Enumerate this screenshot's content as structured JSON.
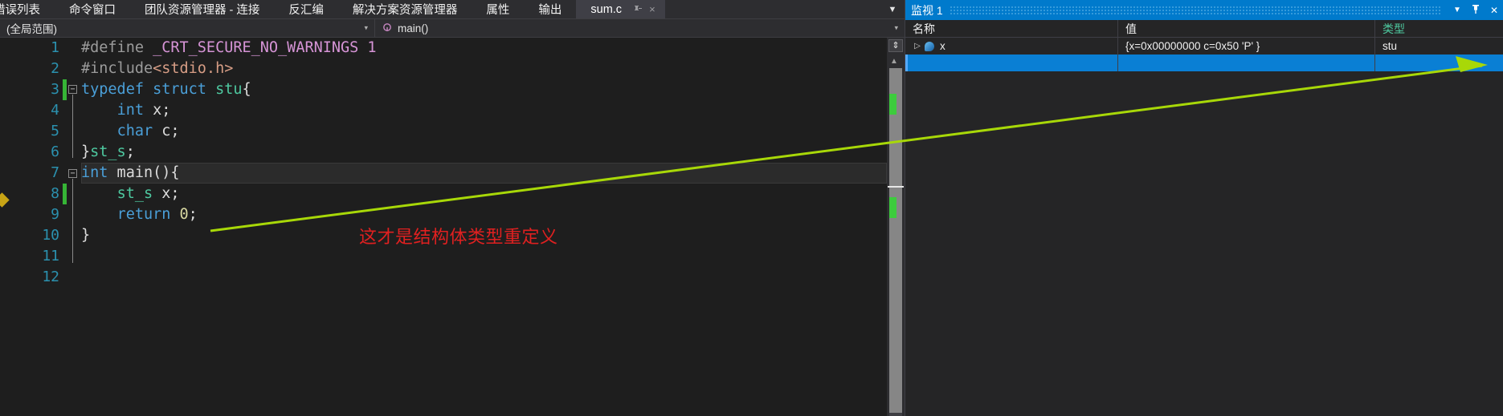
{
  "tabstrip": {
    "tabs": [
      {
        "label": "错误列表",
        "active": false
      },
      {
        "label": "命令窗口",
        "active": false
      },
      {
        "label": "团队资源管理器 - 连接",
        "active": false
      },
      {
        "label": "反汇编",
        "active": false
      },
      {
        "label": "解决方案资源管理器",
        "active": false
      },
      {
        "label": "属性",
        "active": false
      },
      {
        "label": "输出",
        "active": false
      },
      {
        "label": "sum.c",
        "active": true
      }
    ],
    "pin_icon": "pin-icon",
    "close_icon": "×",
    "overflow_icon": "▼"
  },
  "navbar": {
    "scope_value": "(全局范围)",
    "scope_caret": "▾",
    "member_value": "main()",
    "member_glyph": "⬤",
    "member_caret": "▾"
  },
  "editor": {
    "file": "sum.c",
    "line_numbers": [
      "1",
      "2",
      "3",
      "4",
      "5",
      "6",
      "7",
      "8",
      "9",
      "10",
      "11",
      "12"
    ],
    "current_line": 7,
    "annotation": "这才是结构体类型重定义",
    "annotation_color": "#e02020",
    "callout_color": "#a8d808",
    "lines": [
      {
        "n": 1,
        "tokens": [
          {
            "t": "#define ",
            "c": "pp"
          },
          {
            "t": "_CRT_SECURE_NO_WARNINGS ",
            "c": "macro"
          },
          {
            "t": "1",
            "c": "macro"
          }
        ]
      },
      {
        "n": 2,
        "tokens": [
          {
            "t": "#include",
            "c": "pp"
          },
          {
            "t": "<stdio.h>",
            "c": "inc"
          }
        ]
      },
      {
        "n": 3,
        "tokens": [
          {
            "t": "typedef ",
            "c": "kw"
          },
          {
            "t": "struct ",
            "c": "kw"
          },
          {
            "t": "stu",
            "c": "type"
          },
          {
            "t": "{",
            "c": "punct"
          }
        ]
      },
      {
        "n": 4,
        "tokens": [
          {
            "t": "    ",
            "c": "plain"
          },
          {
            "t": "int",
            "c": "kw"
          },
          {
            "t": " x;",
            "c": "plain"
          }
        ]
      },
      {
        "n": 5,
        "tokens": [
          {
            "t": "    ",
            "c": "plain"
          },
          {
            "t": "char",
            "c": "kw"
          },
          {
            "t": " c;",
            "c": "plain"
          }
        ]
      },
      {
        "n": 6,
        "tokens": [
          {
            "t": "}",
            "c": "punct"
          },
          {
            "t": "st_s",
            "c": "type"
          },
          {
            "t": ";",
            "c": "punct"
          }
        ]
      },
      {
        "n": 7,
        "tokens": [
          {
            "t": "int",
            "c": "kw"
          },
          {
            "t": " main(){",
            "c": "plain"
          }
        ]
      },
      {
        "n": 8,
        "tokens": [
          {
            "t": "    ",
            "c": "plain"
          },
          {
            "t": "st_s",
            "c": "type"
          },
          {
            "t": " x;",
            "c": "plain"
          }
        ]
      },
      {
        "n": 9,
        "tokens": [
          {
            "t": "    ",
            "c": "plain"
          },
          {
            "t": "return",
            "c": "kw"
          },
          {
            "t": " ",
            "c": "plain"
          },
          {
            "t": "0",
            "c": "num"
          },
          {
            "t": ";",
            "c": "plain"
          }
        ]
      },
      {
        "n": 10,
        "tokens": [
          {
            "t": "}",
            "c": "punct"
          }
        ]
      },
      {
        "n": 11,
        "tokens": []
      },
      {
        "n": 12,
        "tokens": []
      }
    ],
    "scrollbar": {
      "split_view_icon": "⇕",
      "up_arrow": "▲"
    }
  },
  "watch": {
    "title": "监视 1",
    "caret_icon": "▼",
    "pin_icon": "pin-icon",
    "close_icon": "✕",
    "columns": [
      "名称",
      "值",
      "类型"
    ],
    "rows": [
      {
        "name": "x",
        "value": "{x=0x00000000 c=0x50 'P' }",
        "type": "stu",
        "selected": false,
        "expandable": true
      },
      {
        "name": "",
        "value": "",
        "type": "",
        "selected": true,
        "expandable": false
      }
    ]
  },
  "colors": {
    "accent": "#007acc",
    "selection": "#0a7fd4",
    "editor_bg": "#1e1e1e",
    "chrome_bg": "#2d2d30",
    "panel_bg": "#252526",
    "keyword": "#4a9fd8",
    "type": "#4ec9a0",
    "macro": "#d694d6",
    "include_string": "#d69d85",
    "linenumber": "#2b91af",
    "change_marker": "#36b536"
  }
}
